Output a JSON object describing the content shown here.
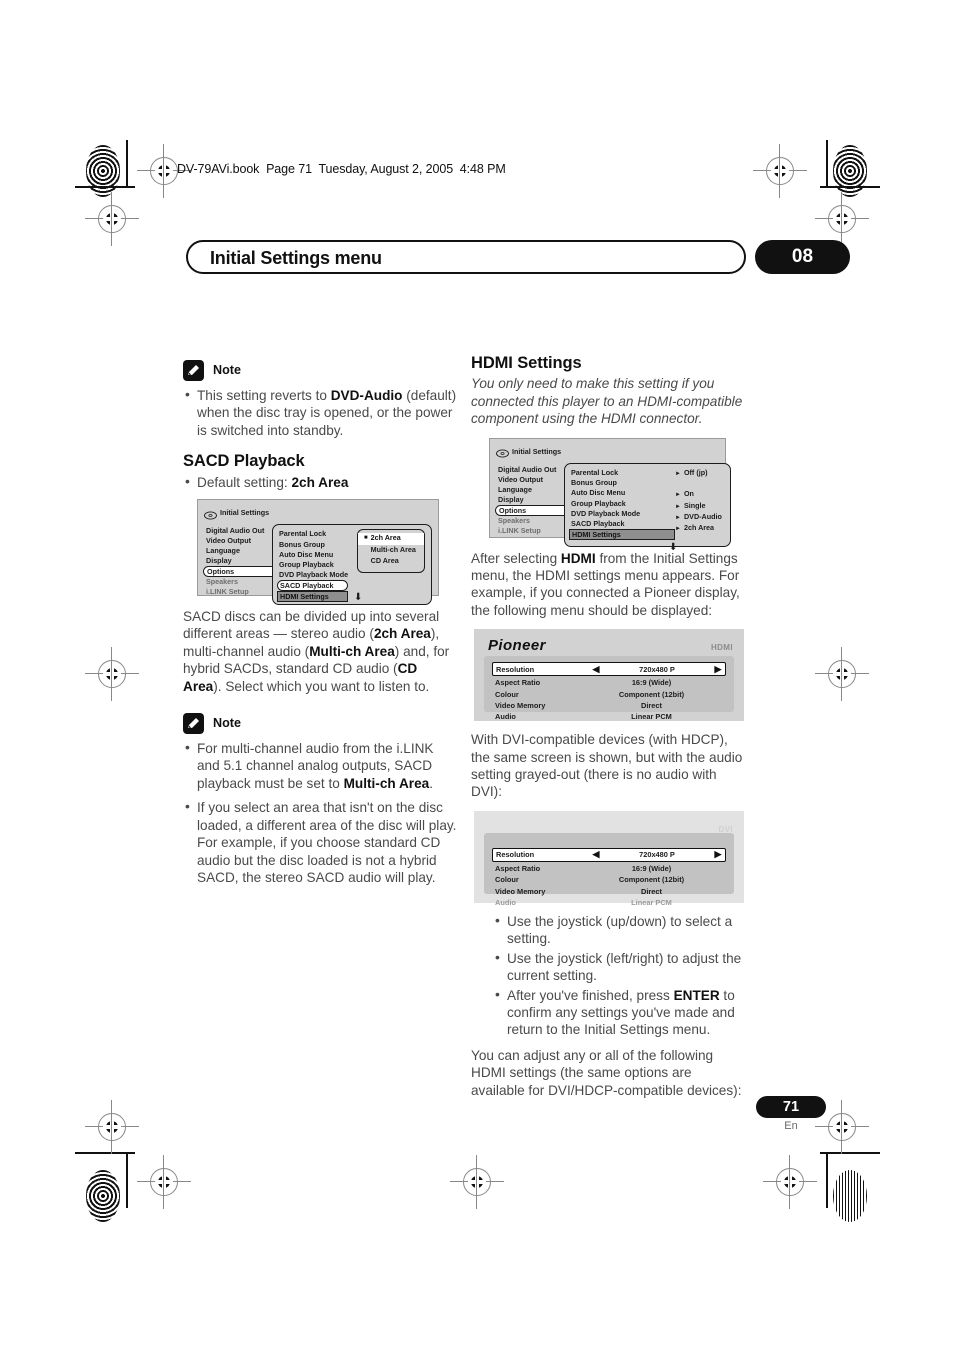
{
  "header": {
    "filestamp": "DV-79AVi.book  Page 71  Tuesday, August 2, 2005  4:48 PM",
    "chapter_title": "Initial Settings menu",
    "chapter_number": "08"
  },
  "footer": {
    "page_number": "71",
    "language_code": "En"
  },
  "left_column": {
    "note1": {
      "label": "Note",
      "items": [
        {
          "pre": "This setting reverts to ",
          "bold": "DVD-Audio",
          "post": " (default) when the disc tray is opened, or the power is switched into standby."
        }
      ]
    },
    "sacd_heading": "SACD Playback",
    "sacd_default": {
      "pre": "Default setting: ",
      "bold": "2ch Area"
    },
    "osd_sacd": {
      "title": "Initial Settings",
      "col1": [
        "Digital Audio Out",
        "Video Output",
        "Language",
        "Display",
        "Options",
        "Speakers",
        "i.LINK Setup"
      ],
      "col1_selected": "Options",
      "col1_dimmed": [
        "Speakers",
        "i.LINK Setup"
      ],
      "col2": [
        "Parental  Lock",
        "Bonus Group",
        "Auto Disc Menu",
        "Group Playback",
        "DVD Playback Mode",
        "SACD Playback",
        "HDMI Settings"
      ],
      "col2_selected": "SACD Playback",
      "col2_highlighted": "HDMI Settings",
      "submenu": [
        "2ch Area",
        "Multi-ch Area",
        "CD Area"
      ],
      "submenu_selected": "2ch Area",
      "down_arrow": "⬇"
    },
    "body": [
      {
        "parts": [
          {
            "t": "SACD discs can be divided up into several different areas — stereo audio ("
          },
          {
            "t": "2ch Area",
            "b": true
          },
          {
            "t": "), multi-channel audio ("
          },
          {
            "t": "Multi-ch Area",
            "b": true
          },
          {
            "t": ") and, for hybrid SACDs, standard CD audio ("
          },
          {
            "t": "CD Area",
            "b": true
          },
          {
            "t": "). Select which you want to listen to."
          }
        ]
      }
    ],
    "note2": {
      "label": "Note",
      "items": [
        {
          "pre": "For multi-channel audio from the i.LINK and 5.1 channel analog outputs, SACD playback must be set to ",
          "bold": "Multi-ch Area",
          "post": "."
        },
        {
          "pre": "If you select an area that isn't on the disc loaded, a different area of the disc will play. For example, if you choose standard CD audio but the disc loaded is not a hybrid SACD, the stereo SACD audio will play.",
          "bold": "",
          "post": ""
        }
      ]
    }
  },
  "right_column": {
    "hdmi_heading": "HDMI Settings",
    "hdmi_intro": "You only need to make this setting if you connected this player to an HDMI-compatible component using the HDMI connector.",
    "osd_hdmi": {
      "title": "Initial Settings",
      "col1": [
        "Digital Audio Out",
        "Video Output",
        "Language",
        "Display",
        "Options",
        "Speakers",
        "i.LINK Setup"
      ],
      "col1_selected": "Options",
      "col1_dimmed": [
        "Speakers",
        "i.LINK Setup"
      ],
      "col2": [
        "Parental  Lock",
        "Bonus Group",
        "Auto Disc Menu",
        "Group Playback",
        "DVD Playback Mode",
        "SACD Playback",
        "HDMI Settings"
      ],
      "col2_highlighted": "HDMI Settings",
      "values": [
        "Off (jp)",
        "",
        "On",
        "Single",
        "DVD-Audio",
        "2ch Area",
        ""
      ],
      "down_arrow": "⬇"
    },
    "para_after_osd": [
      {
        "t": "After selecting "
      },
      {
        "t": "HDMI",
        "b": true
      },
      {
        "t": " from the Initial Settings menu, the HDMI settings menu appears. For example, if you connected a Pioneer display, the following menu should be displayed:"
      }
    ],
    "pioneer_screen": {
      "brand": "Pioneer",
      "tag": "HDMI",
      "rows": [
        {
          "label": "Resolution",
          "value": "720x480 P",
          "active": true,
          "greyed": false
        },
        {
          "label": "Aspect Ratio",
          "value": "16:9 (Wide)",
          "active": false,
          "greyed": false
        },
        {
          "label": "Colour",
          "value": "Component (12bit)",
          "active": false,
          "greyed": false
        },
        {
          "label": "Video Memory",
          "value": "Direct",
          "active": false,
          "greyed": false
        },
        {
          "label": "Audio",
          "value": "Linear PCM",
          "active": false,
          "greyed": false
        }
      ],
      "left_arrow": "◀",
      "right_arrow": "▶"
    },
    "para_dvi": "With DVI-compatible devices (with HDCP), the same screen is shown, but with the audio setting grayed-out (there is no audio with DVI):",
    "dvi_screen": {
      "brand": "",
      "tag": "DVI",
      "rows": [
        {
          "label": "Resolution",
          "value": "720x480 P",
          "active": true,
          "greyed": false
        },
        {
          "label": "Aspect Ratio",
          "value": "16:9 (Wide)",
          "active": false,
          "greyed": false
        },
        {
          "label": "Colour",
          "value": "Component (12bit)",
          "active": false,
          "greyed": false
        },
        {
          "label": "Video Memory",
          "value": "Direct",
          "active": false,
          "greyed": false
        },
        {
          "label": "Audio",
          "value": "Linear PCM",
          "active": false,
          "greyed": true
        }
      ],
      "left_arrow": "◀",
      "right_arrow": "▶"
    },
    "instructions": [
      {
        "pre": "Use the joystick (up/down) to select a setting.",
        "bold": "",
        "post": ""
      },
      {
        "pre": "Use the joystick (left/right) to adjust the current setting.",
        "bold": "",
        "post": ""
      },
      {
        "pre": "After you've finished, press ",
        "bold": "ENTER",
        "post": " to confirm any settings you've made and return to the Initial Settings menu."
      }
    ],
    "closing": "You can adjust any or all of the following HDMI settings (the same options are available for DVI/HDCP-compatible devices):"
  }
}
